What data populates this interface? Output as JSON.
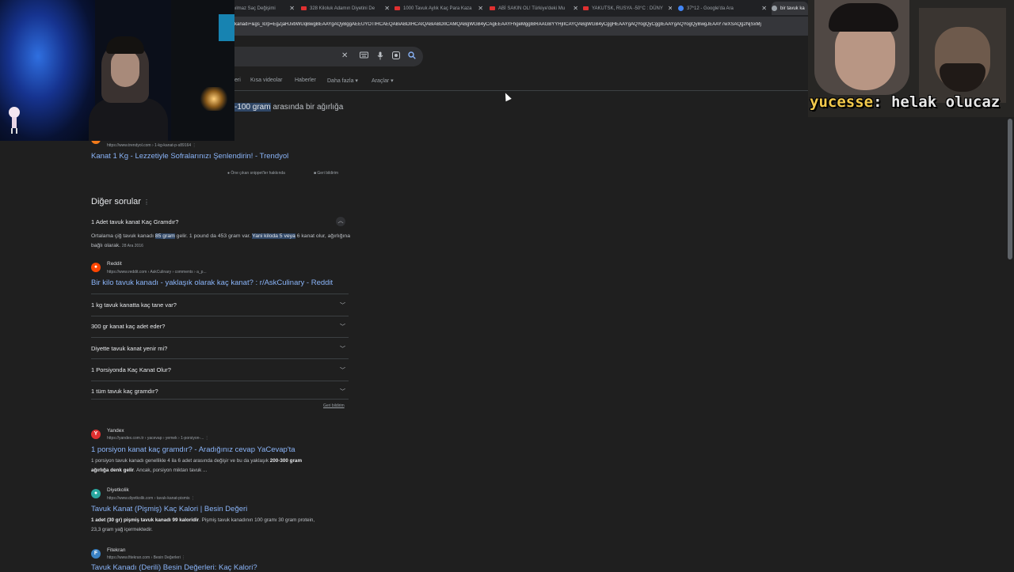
{
  "tabs": [
    {
      "title": "anılmaz Saç Değişimi",
      "icon": "youtube-icon"
    },
    {
      "title": "328 Kiloluk Adamın Diyetini De",
      "icon": "youtube-icon"
    },
    {
      "title": "1000 Tavuk Aylık Kaç Para Kaza",
      "icon": "youtube-icon"
    },
    {
      "title": "ABİ SAKIN OL! Türkiye'deki Mu",
      "icon": "youtube-icon"
    },
    {
      "title": "YAKUTSK, RUSYA -50°C : DÜNY",
      "icon": "youtube-icon"
    },
    {
      "title": "37*12 - Google'da Ara",
      "icon": "google-icon"
    },
    {
      "title": "bir tavuk ka",
      "icon": "google-icon"
    }
  ],
  "url": "kanadı+&gs_lcrp=EgZjaHJvbWUqBwgBEAAYgAQyBggAEEUYOTIHCAEQABiABDIHCAIQABiABDIICAMQABgWGB4yCAgEEAAYFhgeMggIBRAAGBYYHjIICAYQABgWGB4yCggHEAAYgAQYogQyCggIEAAYgAQYogQyBwgJEAAY7wXSAQg2NjSxMj",
  "tab_close": "✕",
  "search": {
    "clear": "✕"
  },
  "nav": [
    "eri",
    "Kısa videolar",
    "Haberler",
    "Daha fazla",
    "Araçlar"
  ],
  "snippet": {
    "highlight": "-100 gram",
    "rest": " arasında bir ağırlığa",
    "source_cite": "https://www.trendyol.com › 1-kg-kanat-p-s89164",
    "link": "Kanat 1 Kg - Lezzetiyle Sofralarınızı Şenlendirin! - Trendyol",
    "about": "Öne çıkan snippet'ler hakkında",
    "feedback": "Geri bildirim"
  },
  "paa": {
    "heading": "Diğer sorular",
    "expanded": {
      "question": "1 Adet tavuk kanat Kaç Gramdır?",
      "text_a": "Ortalama çiğ tavuk kanadı ",
      "hl1": "85 gram",
      "text_b": " gelir. 1 pound da 453 gram var. ",
      "hl2": "Yani kiloda 5 veya",
      "text_c": " 6 kanat olur, ağırlığına bağlı olarak.",
      "date": "28 Ara 2016",
      "site": "Reddit",
      "cite": "https://www.reddit.com › AskCulinary › comments › a_p...",
      "link": "Bir kilo tavuk kanadı - yaklaşık olarak kaç kanat? : r/AskCulinary - Reddit"
    },
    "questions": [
      "1 kg tavuk kanatta kaç tane var?",
      "300 gr kanat kaç adet eder?",
      "Diyette tavuk kanat yenir mi?",
      "1 Porsiyonda Kaç Kanat Olur?",
      "1 tüm tavuk kaç gramdır?"
    ],
    "feedback": "Geri bildirim"
  },
  "results": [
    {
      "site": "Yandex",
      "cite": "https://yandex.com.tr › yacevap › yemek › 1-porsiyon-...",
      "link": "1 porsiyon kanat kaç gramdır? - Aradığınız cevap YaCevap'ta",
      "line1_a": "1 porsiyon tavuk kanadı genellikle 4 ila 6 adet arasında değişir ve bu da yaklaşık ",
      "line1_b": "200-300 gram",
      "line2_a": "ağırlığa denk gelir",
      "line2_b": ". Ancak, porsiyon miktarı tavuk ..."
    },
    {
      "site": "Diyetkolik",
      "cite": "https://www.diyetkolik.com › tavuk-kanat-pismis",
      "link": "Tavuk Kanat (Pişmiş) Kaç Kalori | Besin Değeri",
      "line1_a": "1 adet (30 gr) pişmiş tavuk kanadı 99 kaloridir",
      "line1_b": ". Pişmiş tavuk kanadının 100 gramı 30 gram protein,",
      "line2": "23,3 gram yağ içermektedir."
    },
    {
      "site": "Fitekran",
      "cite": "https://www.fitekran.com › Besin Değerleri",
      "link": "Tavuk Kanadı (Derili) Besin Değerleri: Kaç Kalori?"
    }
  ],
  "overlay": {
    "user": "yucesse",
    "message": ": helak olucaz"
  }
}
